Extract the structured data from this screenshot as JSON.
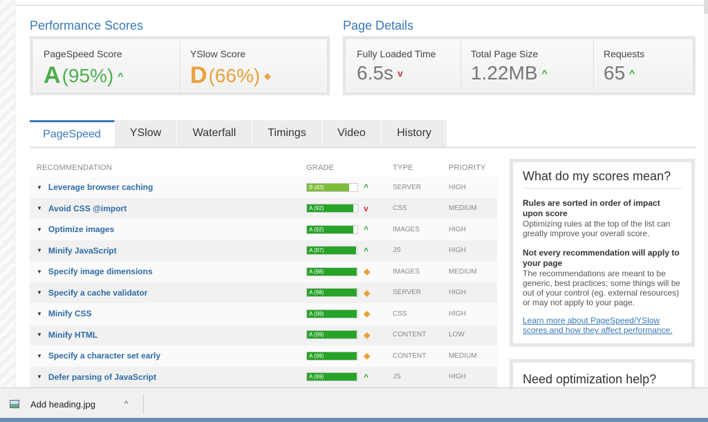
{
  "performance": {
    "title": "Performance Scores",
    "pagespeed": {
      "label": "PageSpeed Score",
      "grade": "A",
      "value": "(95%)"
    },
    "yslow": {
      "label": "YSlow Score",
      "grade": "D",
      "value": "(66%)"
    }
  },
  "details": {
    "title": "Page Details",
    "loaded": {
      "label": "Fully Loaded Time",
      "value": "6.5s"
    },
    "size": {
      "label": "Total Page Size",
      "value": "1.22MB"
    },
    "requests": {
      "label": "Requests",
      "value": "65"
    }
  },
  "tabs": [
    "PageSpeed",
    "YSlow",
    "Waterfall",
    "Timings",
    "Video",
    "History"
  ],
  "table": {
    "headers": {
      "rec": "RECOMMENDATION",
      "grade": "GRADE",
      "type": "TYPE",
      "priority": "PRIORITY"
    },
    "rows": [
      {
        "rec": "Leverage browser caching",
        "grade": "B (83)",
        "pct": 83,
        "trend": "up",
        "type": "SERVER",
        "priority": "HIGH"
      },
      {
        "rec": "Avoid CSS @import",
        "grade": "A (92)",
        "pct": 92,
        "trend": "down",
        "type": "CSS",
        "priority": "MEDIUM"
      },
      {
        "rec": "Optimize images",
        "grade": "A (92)",
        "pct": 92,
        "trend": "up",
        "type": "IMAGES",
        "priority": "HIGH"
      },
      {
        "rec": "Minify JavaScript",
        "grade": "A (97)",
        "pct": 97,
        "trend": "up",
        "type": "JS",
        "priority": "HIGH"
      },
      {
        "rec": "Specify image dimensions",
        "grade": "A (98)",
        "pct": 98,
        "trend": "neutral",
        "type": "IMAGES",
        "priority": "MEDIUM"
      },
      {
        "rec": "Specify a cache validator",
        "grade": "A (98)",
        "pct": 98,
        "trend": "neutral",
        "type": "SERVER",
        "priority": "HIGH"
      },
      {
        "rec": "Minify CSS",
        "grade": "A (99)",
        "pct": 99,
        "trend": "neutral",
        "type": "CSS",
        "priority": "HIGH"
      },
      {
        "rec": "Minify HTML",
        "grade": "A (99)",
        "pct": 99,
        "trend": "neutral",
        "type": "CONTENT",
        "priority": "LOW"
      },
      {
        "rec": "Specify a character set early",
        "grade": "A (99)",
        "pct": 99,
        "trend": "neutral",
        "type": "CONTENT",
        "priority": "MEDIUM"
      },
      {
        "rec": "Defer parsing of JavaScript",
        "grade": "A (99)",
        "pct": 99,
        "trend": "up",
        "type": "JS",
        "priority": "HIGH"
      }
    ]
  },
  "panel": {
    "title": "What do my scores mean?",
    "h1": "Rules are sorted in order of impact upon score",
    "p1": "Optimizing rules at the top of the list can greatly improve your overall score.",
    "h2": "Not every recommendation will apply to your page",
    "p2": "The recommendations are meant to be generic, best practices; some things will be out of your control (eg. external resources) or may not apply to your page.",
    "link": "Learn more about PageSpeed/YSlow scores and how they affect performance."
  },
  "panel2": {
    "title": "Need optimization help?"
  },
  "download": {
    "filename": "Add heading.jpg"
  },
  "colors": {
    "accent": "#3979b8",
    "grade_a": "#27a327",
    "grade_b": "#7cbc3b",
    "grade_d": "#e9a13b",
    "trend_down": "#d0314a"
  }
}
